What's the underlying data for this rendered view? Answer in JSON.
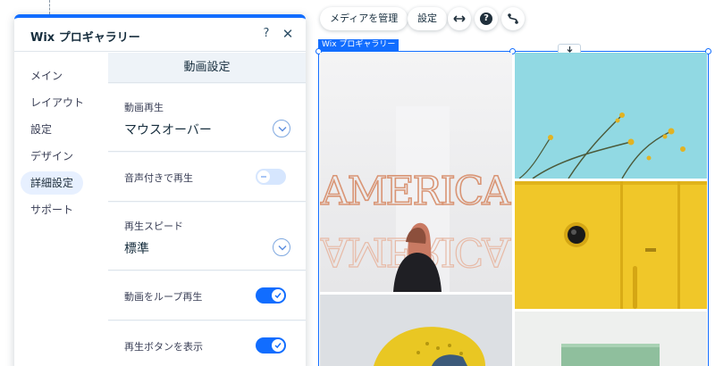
{
  "panel": {
    "title": "Wix プロギャラリー",
    "help_icon": "?",
    "close_icon": "✕"
  },
  "nav": {
    "items": [
      {
        "label": "メイン"
      },
      {
        "label": "レイアウト"
      },
      {
        "label": "設定"
      },
      {
        "label": "デザイン"
      },
      {
        "label": "詳細設定",
        "active": true
      },
      {
        "label": "サポート"
      }
    ]
  },
  "content": {
    "section_title": "動画設定",
    "video_playback": {
      "label": "動画再生",
      "value": "マウスオーバー"
    },
    "play_with_sound": {
      "label": "音声付きで再生",
      "checked": false
    },
    "playback_speed": {
      "label": "再生スピード",
      "value": "標準"
    },
    "loop_video": {
      "label": "動画をループ再生",
      "checked": true
    },
    "show_play_button": {
      "label": "再生ボタンを表示",
      "checked": true
    }
  },
  "toolbar": {
    "manage_media": "メディアを管理",
    "settings": "設定",
    "help": "?"
  },
  "gallery": {
    "tag": "Wix プロギャラリー",
    "neon_text": "AMERICA"
  },
  "colors": {
    "accent": "#116dff",
    "toggle_off": "#d6e6fe",
    "selected_nav": "#e7f0ff",
    "panel_bg": "#f4f8fc",
    "yellow": "#f1c92c",
    "sky": "#8fd8e3"
  }
}
